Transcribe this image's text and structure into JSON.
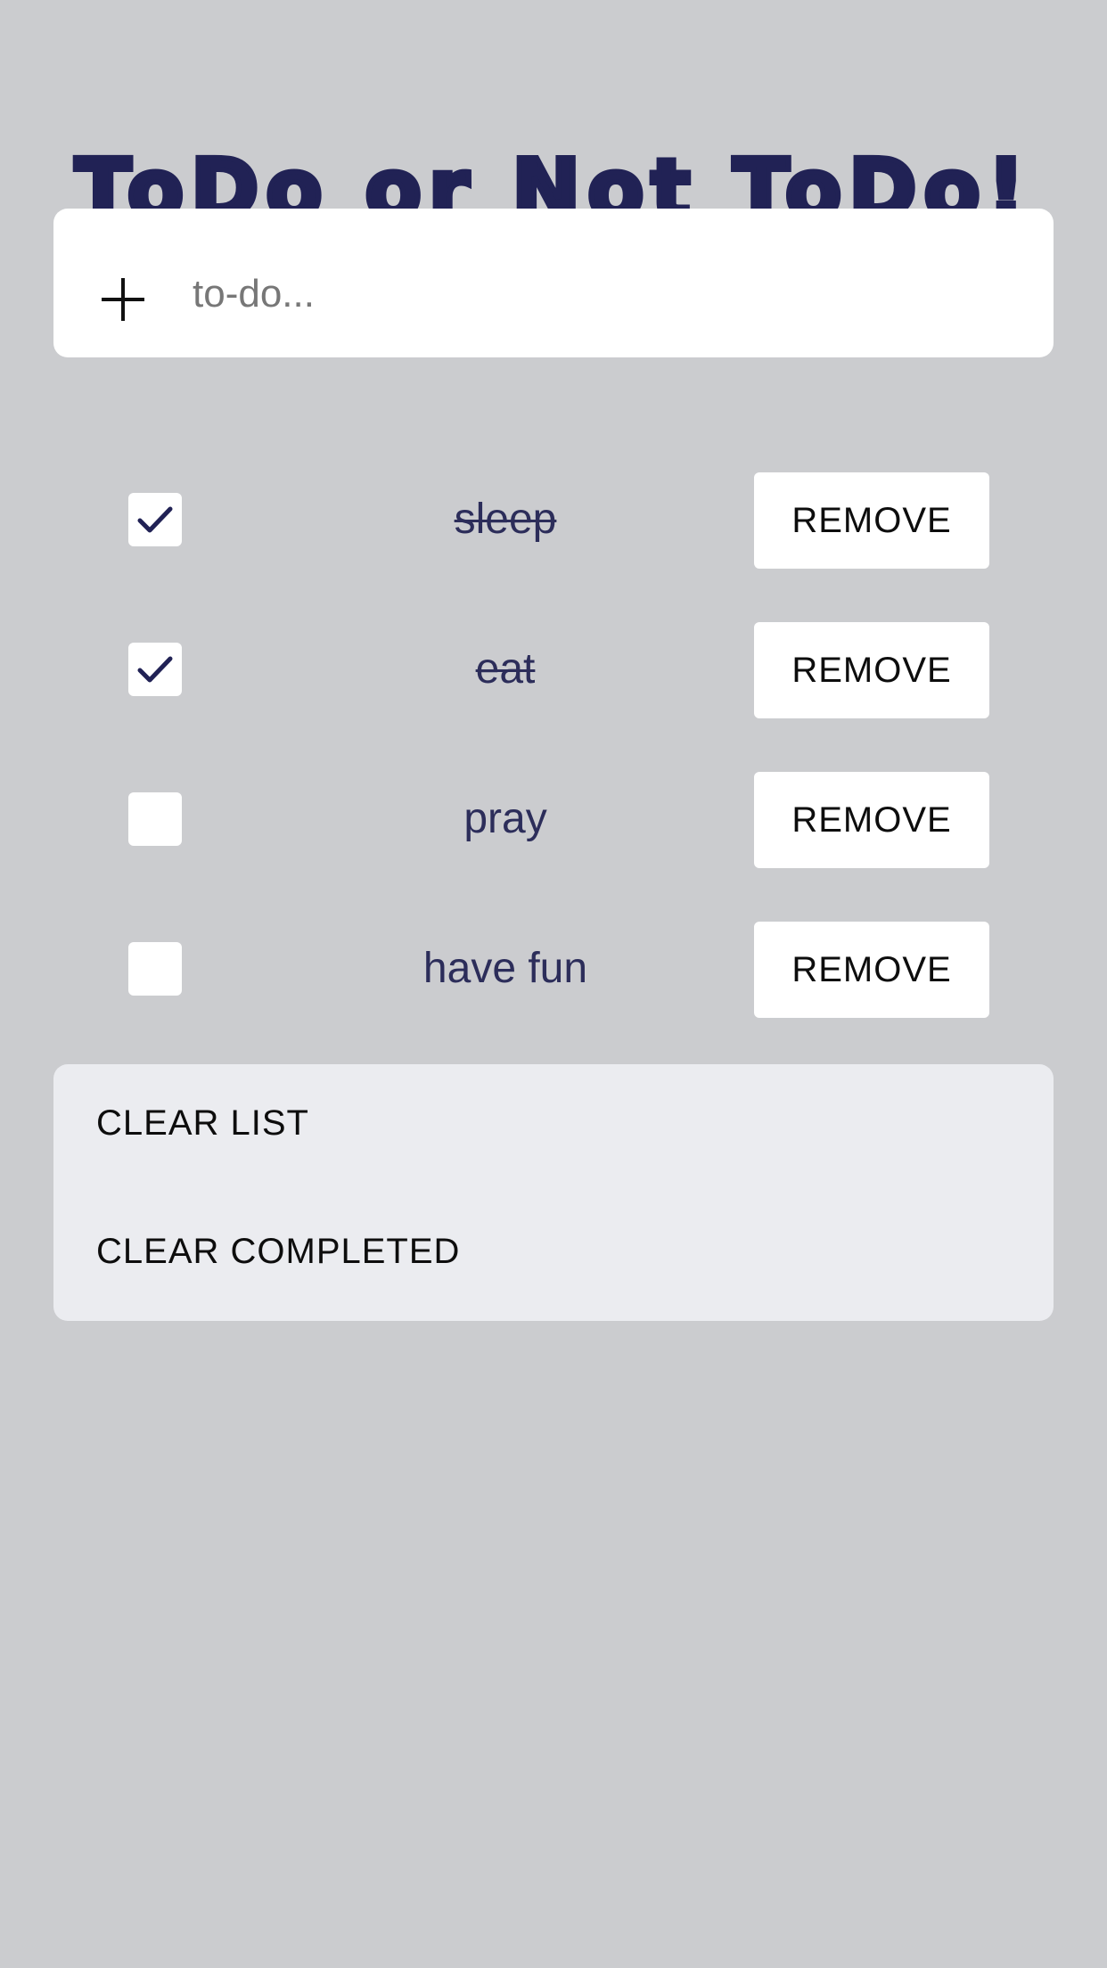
{
  "app": {
    "title": "ToDo or Not ToDo!"
  },
  "input": {
    "add_icon": "plus-icon",
    "placeholder": "to-do...",
    "value": ""
  },
  "todos": [
    {
      "text": "sleep",
      "completed": true,
      "remove_label": "REMOVE"
    },
    {
      "text": "eat",
      "completed": true,
      "remove_label": "REMOVE"
    },
    {
      "text": "pray",
      "completed": false,
      "remove_label": "REMOVE"
    },
    {
      "text": "have fun",
      "completed": false,
      "remove_label": "REMOVE"
    }
  ],
  "footer": {
    "clear_list_label": "CLEAR LIST",
    "clear_completed_label": "CLEAR COMPLETED"
  },
  "colors": {
    "background": "#cbcccf",
    "accent": "#212255",
    "card": "#ffffff",
    "footer_card": "#ebecf0"
  }
}
